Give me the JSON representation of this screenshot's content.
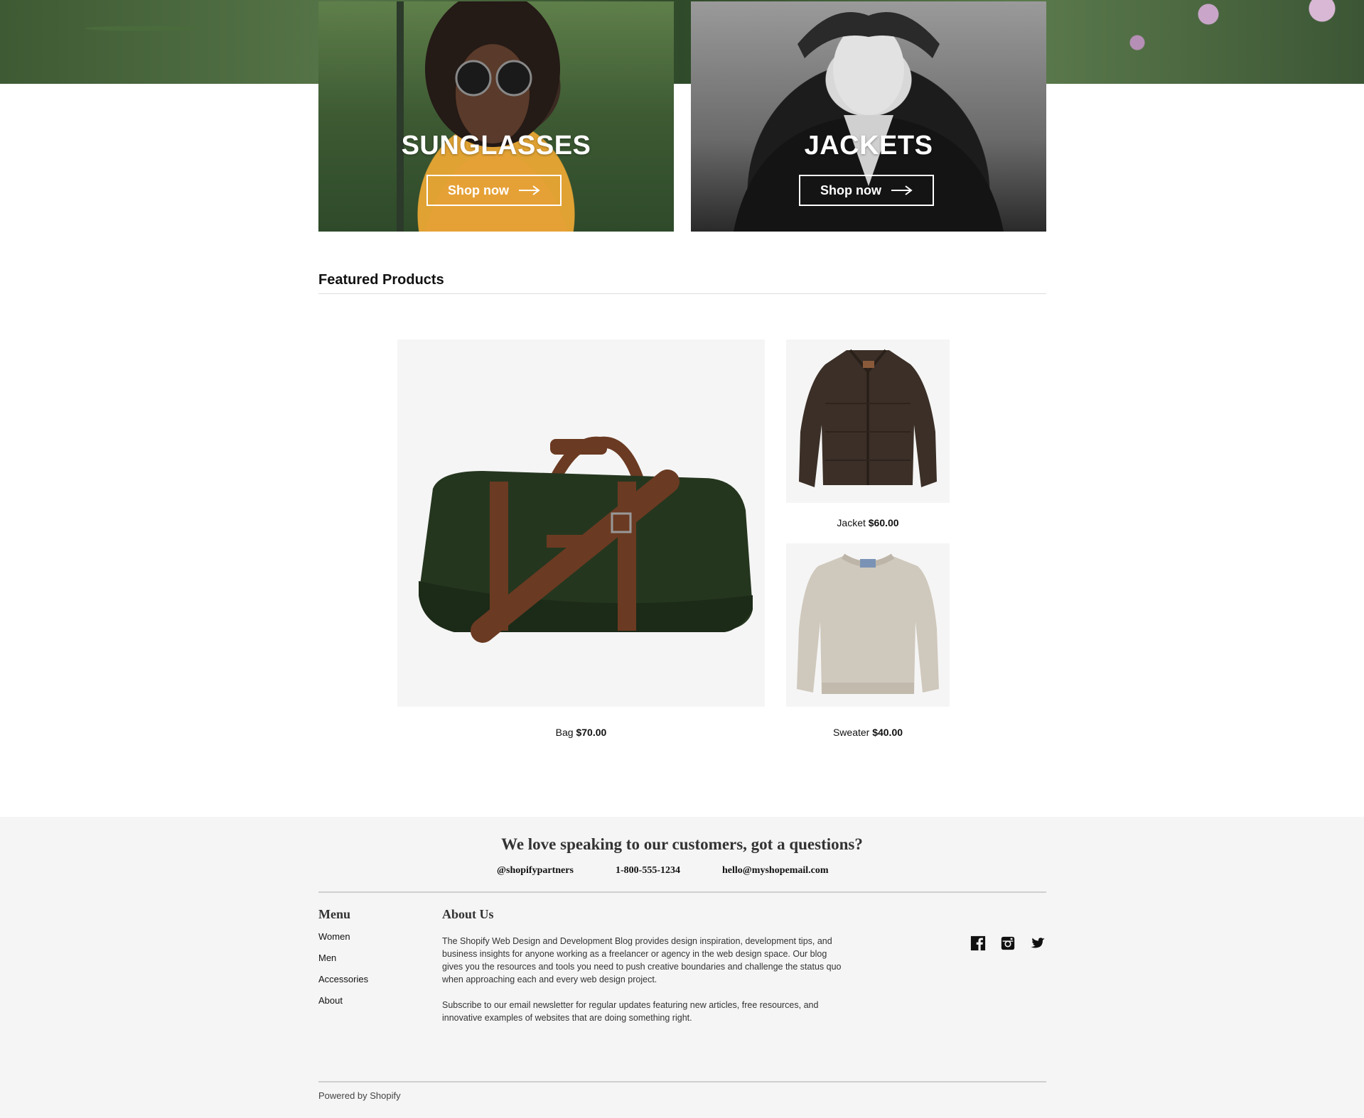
{
  "promos": [
    {
      "title": "SUNGLASSES",
      "button_label": "Shop now"
    },
    {
      "title": "JACKETS",
      "button_label": "Shop now"
    }
  ],
  "featured": {
    "title": "Featured Products",
    "products": [
      {
        "name": "Bag",
        "price": "$70.00"
      },
      {
        "name": "Jacket",
        "price": "$60.00"
      },
      {
        "name": "Sweater",
        "price": "$40.00"
      }
    ]
  },
  "footer": {
    "headline": "We love speaking to our customers, got a questions?",
    "contact": {
      "handle": "@shopifypartners",
      "phone": "1-800-555-1234",
      "email": "hello@myshopemail.com"
    },
    "menu": {
      "heading": "Menu",
      "items": [
        "Women",
        "Men",
        "Accessories",
        "About"
      ]
    },
    "about": {
      "heading": "About Us",
      "paragraph1": "The Shopify Web Design and Development Blog provides design inspiration, development tips, and business insights for anyone working as a freelancer or agency in the web design space. Our blog gives you the resources and tools you need to push creative boundaries and challenge the status quo when approaching each and every web design project.",
      "paragraph2": "Subscribe to our email newsletter for regular updates featuring new articles, free resources, and innovative examples of websites that are doing something right."
    },
    "social_icons": [
      "facebook-icon",
      "instagram-icon",
      "twitter-icon"
    ],
    "powered_by": "Powered by Shopify"
  }
}
